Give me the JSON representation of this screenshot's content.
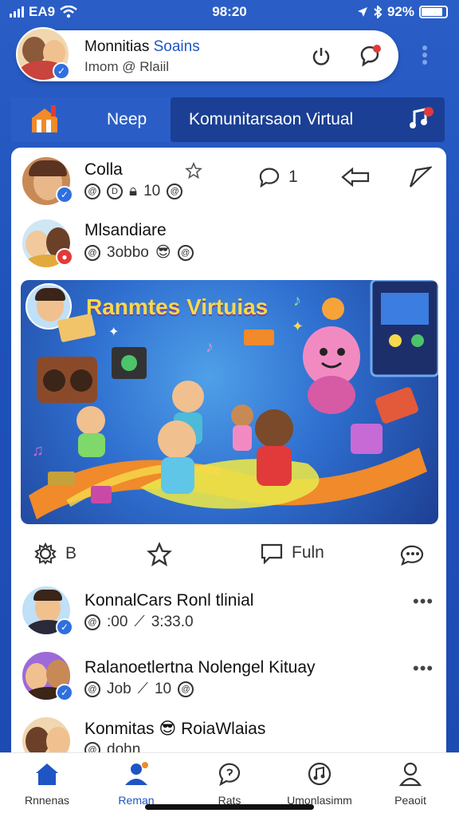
{
  "status_bar": {
    "carrier": "EA9",
    "time": "98:20",
    "battery": "92%"
  },
  "profile": {
    "name_part1": "Monnitias ",
    "name_part2": "Soains",
    "handle": "Imom @ Rlaiil"
  },
  "tabs": [
    {
      "label": "Neep"
    },
    {
      "label": "Komunitarsaon Virtual"
    }
  ],
  "posts": [
    {
      "name": "Colla",
      "meta": [
        "10"
      ],
      "comments": "1"
    },
    {
      "name": "Mlsandiare",
      "meta": [
        "3obbo"
      ]
    }
  ],
  "hero": {
    "title": "Ranmtes Virtuias"
  },
  "actions": {
    "left_count": "B",
    "comment_label": "Fuln"
  },
  "list": [
    {
      "name": "KonnalCars Ronl tlinial",
      "meta1": ":00",
      "meta2": "3:33.0"
    },
    {
      "name": "Ralanoetlertna Nolengel Kituay",
      "meta1": "Job",
      "meta2": "10"
    },
    {
      "name": "Konmitas",
      "name2": "RoiaWlaias",
      "meta1": "dohn"
    }
  ],
  "bottom_nav": [
    {
      "label": "Rnnenas",
      "icon": "home-icon"
    },
    {
      "label": "Reman",
      "icon": "people-icon"
    },
    {
      "label": "Rats",
      "icon": "chat-icon"
    },
    {
      "label": "Umonlasimm",
      "icon": "music-icon"
    },
    {
      "label": "Peaoit",
      "icon": "profile-icon"
    }
  ],
  "colors": {
    "primary": "#2a5ec6",
    "tab_active": "#1b3f94",
    "accent_yellow": "#f6d94c",
    "badge": "#2f6fe0"
  }
}
